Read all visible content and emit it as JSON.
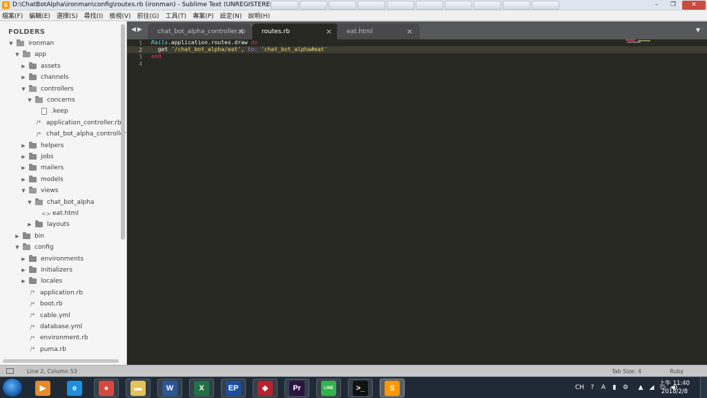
{
  "window": {
    "title": "D:\\ChatBotAlpha\\ironman\\config\\routes.rb (ironman) - Sublime Text (UNREGISTERED)",
    "controls": [
      "–",
      "❐",
      "✕"
    ]
  },
  "menu": [
    "檔案(F)",
    "編輯(E)",
    "選擇(S)",
    "尋找(I)",
    "檢視(V)",
    "前往(G)",
    "工具(T)",
    "專案(P)",
    "設定(N)",
    "說明(H)"
  ],
  "sidebar": {
    "title": "FOLDERS",
    "items": [
      {
        "label": "ironman",
        "type": "folder",
        "open": true,
        "depth": 0
      },
      {
        "label": "app",
        "type": "folder",
        "open": true,
        "depth": 1
      },
      {
        "label": "assets",
        "type": "folder",
        "open": false,
        "depth": 2
      },
      {
        "label": "channels",
        "type": "folder",
        "open": false,
        "depth": 2
      },
      {
        "label": "controllers",
        "type": "folder",
        "open": true,
        "depth": 2
      },
      {
        "label": "concerns",
        "type": "folder",
        "open": true,
        "depth": 3
      },
      {
        "label": ".keep",
        "type": "doc",
        "depth": 4
      },
      {
        "label": "application_controller.rb",
        "type": "code",
        "depth": 3
      },
      {
        "label": "chat_bot_alpha_controller.rb",
        "type": "code",
        "depth": 3
      },
      {
        "label": "helpers",
        "type": "folder",
        "open": false,
        "depth": 2
      },
      {
        "label": "jobs",
        "type": "folder",
        "open": false,
        "depth": 2
      },
      {
        "label": "mailers",
        "type": "folder",
        "open": false,
        "depth": 2
      },
      {
        "label": "models",
        "type": "folder",
        "open": false,
        "depth": 2
      },
      {
        "label": "views",
        "type": "folder",
        "open": true,
        "depth": 2
      },
      {
        "label": "chat_bot_alpha",
        "type": "folder",
        "open": true,
        "depth": 3
      },
      {
        "label": "eat.html",
        "type": "html",
        "depth": 4
      },
      {
        "label": "layouts",
        "type": "folder",
        "open": false,
        "depth": 3
      },
      {
        "label": "bin",
        "type": "folder",
        "open": false,
        "depth": 1
      },
      {
        "label": "config",
        "type": "folder",
        "open": true,
        "depth": 1
      },
      {
        "label": "environments",
        "type": "folder",
        "open": false,
        "depth": 2
      },
      {
        "label": "initializers",
        "type": "folder",
        "open": false,
        "depth": 2
      },
      {
        "label": "locales",
        "type": "folder",
        "open": false,
        "depth": 2
      },
      {
        "label": "application.rb",
        "type": "code",
        "depth": 2
      },
      {
        "label": "boot.rb",
        "type": "code",
        "depth": 2
      },
      {
        "label": "cable.yml",
        "type": "code",
        "depth": 2
      },
      {
        "label": "database.yml",
        "type": "code",
        "depth": 2
      },
      {
        "label": "environment.rb",
        "type": "code",
        "depth": 2
      },
      {
        "label": "puma.rb",
        "type": "code",
        "depth": 2
      }
    ]
  },
  "tabs": [
    {
      "label": "chat_bot_alpha_controller.rb",
      "active": false
    },
    {
      "label": "routes.rb",
      "active": true
    },
    {
      "label": "eat.html",
      "active": false
    }
  ],
  "editor": {
    "line_numbers": [
      "1",
      "2",
      "3",
      "4"
    ],
    "current_line": 2,
    "code": {
      "l1_const": "Rails",
      "l1_text": ".application.routes.draw ",
      "l1_kw": "do",
      "l2_text": "  get ",
      "l2_str1": "'/chat_bot_alpha/eat'",
      "l2_comma": ", ",
      "l2_sym": "to:",
      "l2_space": " ",
      "l2_str2": "'chat_bot_alpha#eat'",
      "l3_kw": "end"
    }
  },
  "status": {
    "position": "Line 2, Column 53",
    "tab_size": "Tab Size: 4",
    "syntax": "Ruby"
  },
  "taskbar": {
    "apps": [
      {
        "name": "media-player",
        "glyph": "▶",
        "color": "#e58a2a"
      },
      {
        "name": "internet-explorer",
        "glyph": "e",
        "color": "#1d8fdc"
      },
      {
        "name": "chrome",
        "glyph": "●",
        "color": "#d8493c"
      },
      {
        "name": "file-explorer",
        "glyph": "▬",
        "color": "#e4c25b"
      },
      {
        "name": "word",
        "glyph": "W",
        "color": "#2b5797"
      },
      {
        "name": "excel",
        "glyph": "X",
        "color": "#207245"
      },
      {
        "name": "ep",
        "glyph": "EP",
        "color": "#1b4fa0"
      },
      {
        "name": "app-diamond",
        "glyph": "◈",
        "color": "#b8202c"
      },
      {
        "name": "premiere",
        "glyph": "Pr",
        "color": "#2a1440"
      },
      {
        "name": "line",
        "glyph": "LINE",
        "color": "#2fb34a"
      },
      {
        "name": "terminal",
        "glyph": ">_",
        "color": "#111111"
      },
      {
        "name": "sublime-text",
        "glyph": "S",
        "color": "#ff9800"
      }
    ],
    "tray": {
      "lang": "CH",
      "icons": [
        "help-icon",
        "a-icon",
        "keyboard-icon",
        "settings-icon",
        "up-arrow-icon",
        "wifi-icon",
        "battery-icon",
        "volume-icon"
      ],
      "time": "上午 11:40",
      "date": "2018/2/8"
    }
  },
  "colors": {
    "editor_bg": "#272822",
    "keyword": "#f92672",
    "string": "#e6db74",
    "constant": "#66d9ef",
    "symbol": "#ae81ff"
  }
}
